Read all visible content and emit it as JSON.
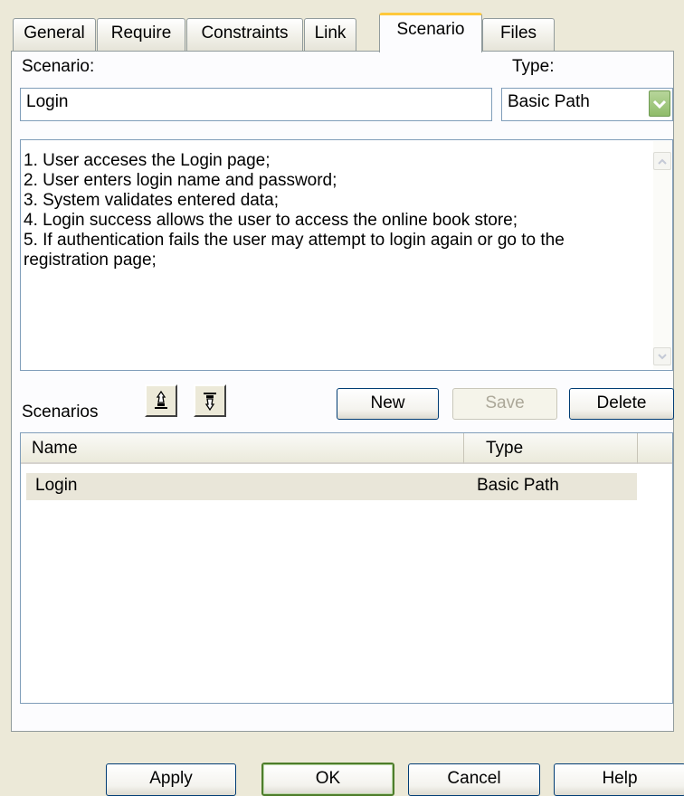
{
  "tabs": [
    {
      "label": "General"
    },
    {
      "label": "Require"
    },
    {
      "label": "Constraints"
    },
    {
      "label": "Link"
    },
    {
      "label": "Scenario"
    },
    {
      "label": "Files"
    }
  ],
  "scenario_label": "Scenario:",
  "scenario_value": "Login",
  "type_label": "Type:",
  "type_value": "Basic Path",
  "description_lines": [
    "1. User acceses the Login page;",
    "2. User enters login name and password;",
    "3. System validates entered data;",
    "4. Login success allows the user to access the online book store;",
    "5. If authentication fails the user may attempt to login again or go to the",
    "registration page;"
  ],
  "scenarios_label": "Scenarios",
  "buttons": {
    "new": "New",
    "save": "Save",
    "delete": "Delete",
    "apply": "Apply",
    "ok": "OK",
    "cancel": "Cancel",
    "help": "Help"
  },
  "grid": {
    "columns": [
      "Name",
      "Type"
    ],
    "rows": [
      {
        "name": "Login",
        "type": "Basic Path"
      }
    ]
  }
}
